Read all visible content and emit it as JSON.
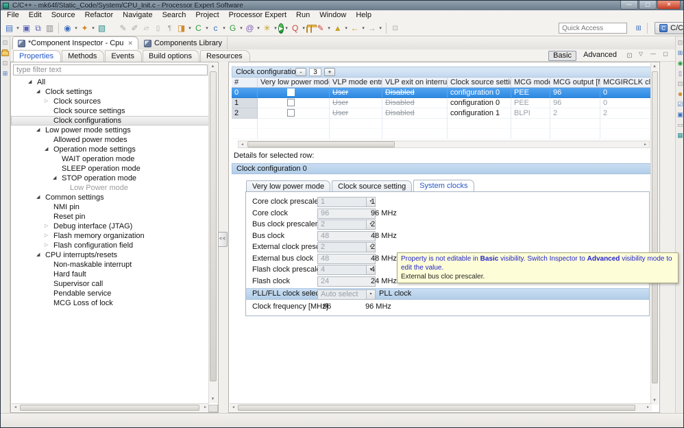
{
  "window": {
    "title": "C/C++ - mk64f/Static_Code/System/CPU_Init.c - Processor Expert Software",
    "menus": [
      "File",
      "Edit",
      "Source",
      "Refactor",
      "Navigate",
      "Search",
      "Project",
      "Processor Expert",
      "Run",
      "Window",
      "Help"
    ]
  },
  "toolbar": {
    "quick_access": "Quick Access",
    "perspective": "C/C++"
  },
  "editor_tabs": {
    "inspector": "*Component Inspector - Cpu",
    "library": "Components Library"
  },
  "view_tabs": {
    "properties": "Properties",
    "methods": "Methods",
    "events": "Events",
    "build_options": "Build options",
    "resources": "Resources",
    "basic": "Basic",
    "advanced": "Advanced"
  },
  "tree": {
    "filter": "type filter text",
    "items": [
      "All",
      "Clock settings",
      "Clock sources",
      "Clock source settings",
      "Clock configurations",
      "Low power mode settings",
      "Allowed power modes",
      "Operation mode settings",
      "WAIT operation mode",
      "SLEEP operation mode",
      "STOP operation mode",
      "Low Power mode",
      "Common settings",
      "NMI pin",
      "Reset pin",
      "Debug interface (JTAG)",
      "Flash memory organization",
      "Flash configuration field",
      "CPU interrupts/resets",
      "Non-maskable interrupt",
      "Hard fault",
      "Supervisor call",
      "Pendable service",
      "MCG Loss of lock"
    ]
  },
  "config": {
    "title": "Clock configurations",
    "minus": "-",
    "count": "3",
    "plus": "+",
    "columns": [
      "#",
      "Very low power mode",
      "VLP mode entry",
      "VLP exit on interrupt",
      "Clock source setting",
      "MCG mode",
      "MCG output [MHz]",
      "MCGIRCLK clock [M"
    ],
    "rows": [
      {
        "n": "0",
        "entry": "User",
        "exit": "Disabled",
        "src": "configuration 0",
        "mcg": "PEE",
        "out": "96",
        "irc": "0"
      },
      {
        "n": "1",
        "entry": "User",
        "exit": "Disabled",
        "src": "configuration 0",
        "mcg": "PEE",
        "out": "96",
        "irc": "0"
      },
      {
        "n": "2",
        "entry": "User",
        "exit": "Disabled",
        "src": "configuration 1",
        "mcg": "BLPI",
        "out": "2",
        "irc": "2"
      }
    ]
  },
  "details": {
    "caption": "Details for selected row:",
    "header": "Clock configuration 0",
    "tabs": {
      "vlp": "Very low power mode",
      "src": "Clock source setting",
      "sys": "System clocks"
    },
    "rows": [
      {
        "label": "Core clock prescaler",
        "value": "1",
        "display": "1"
      },
      {
        "label": "Core clock",
        "value": "96",
        "display": "96 MHz"
      },
      {
        "label": "Bus clock prescaler",
        "value": "2",
        "display": "2"
      },
      {
        "label": "Bus clock",
        "value": "48",
        "display": "48 MHz"
      },
      {
        "label": "External clock prescaler",
        "value": "2",
        "display": "2"
      },
      {
        "label": "External bus clock",
        "value": "48",
        "display": "48 MHz"
      },
      {
        "label": "Flash clock prescaler",
        "value": "4",
        "display": "4"
      },
      {
        "label": "Flash clock",
        "value": "24",
        "display": "24 MHz"
      }
    ],
    "pll": {
      "label": "PLL/FLL clock selection",
      "value": "Auto select",
      "display": "PLL clock"
    },
    "freq": {
      "label": "Clock frequency [MHz]",
      "value": "96",
      "display": "96 MHz"
    }
  },
  "tooltip": {
    "p1": "Property is not editable in ",
    "b1": "Basic",
    "p2": " visibility. Switch Inspector to ",
    "b2": "Advanced",
    "p3": " visibility mode to edit the value.",
    "line2": "External bus cloc prescaler."
  },
  "icons": {
    "new": "▤",
    "save": "▣",
    "save_all": "⧉",
    "print": "▥",
    "debug": "◉",
    "build": "✦",
    "generate": "▧",
    "pen": "✎",
    "brush": "✐",
    "stamp": "▱",
    "block": "▯",
    "pilcrow": "¶",
    "package": "◨",
    "class_c": "C",
    "file_c": "c",
    "class_g": "G",
    "at": "@",
    "settings": "✳",
    "run": "▶",
    "run_q": "Q",
    "back": "←",
    "forward": "→",
    "link": "⊡",
    "caret": "▾",
    "vmenu": "▽",
    "minimize": "—",
    "maximize": "▢",
    "close": "✕",
    "window": "⊡",
    "tree": "⊞",
    "target": "◉",
    "device": "▯",
    "user": "☻",
    "check": "☑",
    "monitor": "▣",
    "panel": "▭",
    "table": "▦",
    "up": "▲",
    "down": "▼",
    "left": "◂",
    "right": "▸",
    "arrow_open": "◢",
    "arrow_closed": "▷",
    "collapse": "<<"
  },
  "colors": {
    "selection_blue": "#3294ea",
    "config_header_bar": "#cbdff2",
    "details_bar": "#bcd6ee",
    "tooltip_bg": "#fdfdd8",
    "tab_active_text": "#2456c5",
    "titlebar": "#7c8d9b"
  }
}
